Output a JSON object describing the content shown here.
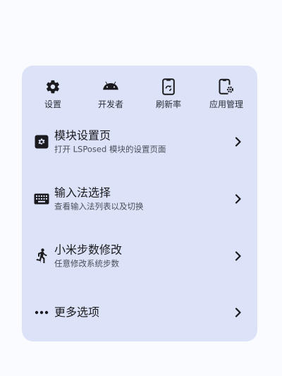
{
  "shortcuts": [
    {
      "label": "设置",
      "icon": "gear-icon"
    },
    {
      "label": "开发者",
      "icon": "android-icon"
    },
    {
      "label": "刷新率",
      "icon": "phone-refresh-icon"
    },
    {
      "label": "应用管理",
      "icon": "phone-settings-icon"
    }
  ],
  "menu": [
    {
      "title": "模块设置页",
      "subtitle": "打开 LSPosed 模块的设置页面",
      "icon": "gear-square-icon"
    },
    {
      "title": "输入法选择",
      "subtitle": "查看输入法列表以及切换",
      "icon": "keyboard-icon"
    },
    {
      "title": "小米步数修改",
      "subtitle": "任意修改系统步数",
      "icon": "walking-icon"
    },
    {
      "title": "更多选项",
      "subtitle": "",
      "icon": "more-dots-icon"
    }
  ],
  "colors": {
    "background": "#fafbff",
    "card": "#dce3f8",
    "icon": "#1b1b1f"
  }
}
